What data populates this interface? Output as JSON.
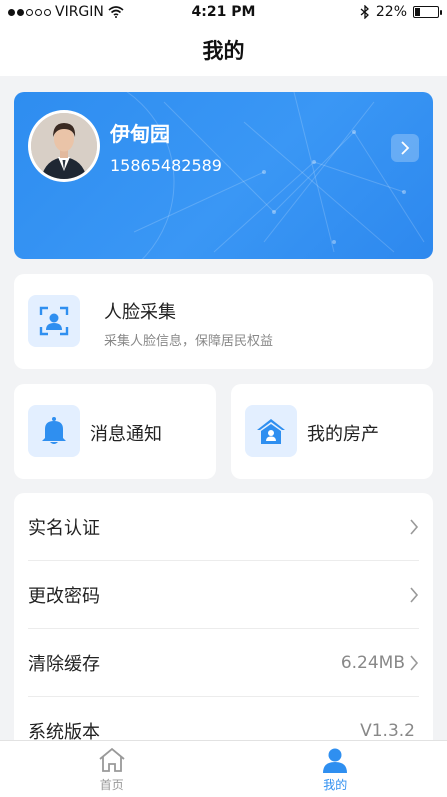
{
  "status_bar": {
    "carrier": "VIRGIN",
    "time": "4:21 PM",
    "battery_text": "22%",
    "battery_level": 0.22
  },
  "header": {
    "title": "我的"
  },
  "profile": {
    "name": "伊甸园",
    "phone": "15865482589"
  },
  "face_card": {
    "title": "人脸采集",
    "subtitle": "采集人脸信息，保障居民权益"
  },
  "quick_actions": [
    {
      "label": "消息通知",
      "icon": "bell-icon"
    },
    {
      "label": "我的房产",
      "icon": "house-icon"
    }
  ],
  "menu": [
    {
      "label": "实名认证",
      "value": ""
    },
    {
      "label": "更改密码",
      "value": ""
    },
    {
      "label": "清除缓存",
      "value": "6.24MB"
    },
    {
      "label": "系统版本",
      "value": "V1.3.2"
    }
  ],
  "tabbar": {
    "items": [
      {
        "label": "首页",
        "icon": "home-icon",
        "active": false
      },
      {
        "label": "我的",
        "icon": "person-icon",
        "active": true
      }
    ]
  },
  "colors": {
    "accent": "#2f8ff0",
    "icon_bg": "#e3efff",
    "inactive_tab": "#999999"
  }
}
